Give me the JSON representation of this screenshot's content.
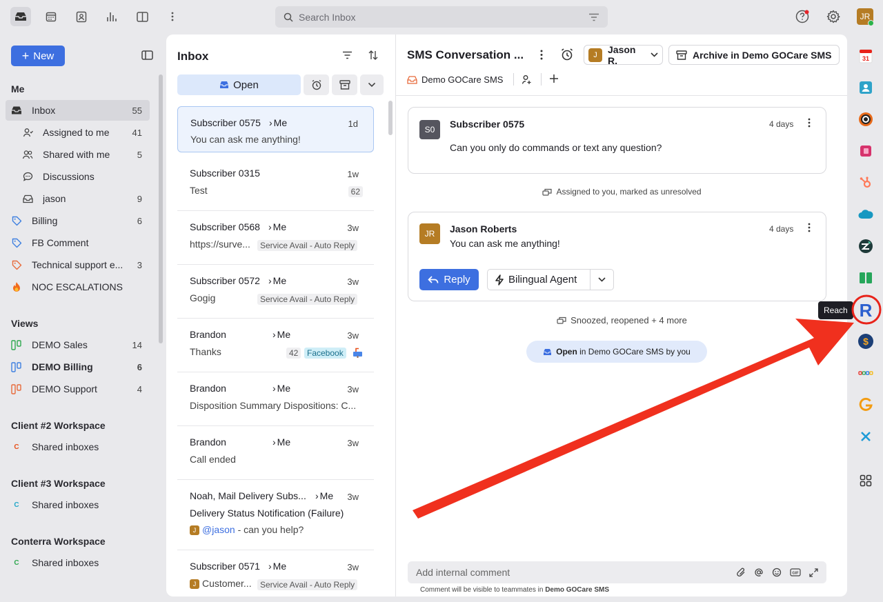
{
  "topbar": {
    "search_placeholder": "Search Inbox",
    "avatar_initials": "JR",
    "icons": [
      "inbox-icon",
      "calendar-icon",
      "contacts-icon",
      "analytics-icon",
      "columns-icon",
      "more-icon"
    ]
  },
  "sidebar": {
    "new_label": "New",
    "me_heading": "Me",
    "me_items": [
      {
        "label": "Inbox",
        "count": "55"
      },
      {
        "label": "Assigned to me",
        "count": "41"
      },
      {
        "label": "Shared with me",
        "count": "5"
      },
      {
        "label": "Discussions",
        "count": ""
      },
      {
        "label": "jason",
        "count": "9"
      },
      {
        "label": "Billing",
        "count": "6"
      },
      {
        "label": "FB Comment",
        "count": ""
      },
      {
        "label": "Technical support e...",
        "count": "3"
      },
      {
        "label": "NOC ESCALATIONS",
        "count": ""
      }
    ],
    "views_heading": "Views",
    "views": [
      {
        "label": "DEMO Sales",
        "count": "14"
      },
      {
        "label": "DEMO Billing",
        "count": "6"
      },
      {
        "label": "DEMO Support",
        "count": "4"
      }
    ],
    "workspaces": [
      {
        "heading": "Client #2 Workspace",
        "item": "Shared inboxes",
        "dot": "C"
      },
      {
        "heading": "Client #3 Workspace",
        "item": "Shared inboxes",
        "dot": "C"
      },
      {
        "heading": "Conterra Workspace",
        "item": "Shared inboxes",
        "dot": "C"
      }
    ]
  },
  "list": {
    "title": "Inbox",
    "open_label": "Open",
    "rows": [
      {
        "name": "Subscriber 0575",
        "me": "Me",
        "time": "1d",
        "preview": "You can ask me anything!",
        "tag": "",
        "badge": ""
      },
      {
        "name": "Subscriber 0315",
        "me": "",
        "time": "1w",
        "preview": "Test",
        "tag": "",
        "badge": "62"
      },
      {
        "name": "Subscriber 0568",
        "me": "Me",
        "time": "3w",
        "preview": "https://surve...",
        "tag": "Service Avail - Auto Reply",
        "badge": ""
      },
      {
        "name": "Subscriber 0572",
        "me": "Me",
        "time": "3w",
        "preview": "Gogig",
        "tag": "Service Avail - Auto Reply",
        "badge": ""
      },
      {
        "name": "Brandon",
        "me": "Me",
        "time": "3w",
        "preview": "Thanks",
        "tag": "Facebook",
        "badge": "42"
      },
      {
        "name": "Brandon",
        "me": "Me",
        "time": "3w",
        "preview": "Disposition Summary Dispositions: C...",
        "tag": "",
        "badge": ""
      },
      {
        "name": "Brandon",
        "me": "Me",
        "time": "3w",
        "preview": "Call ended",
        "tag": "",
        "badge": ""
      },
      {
        "name": "Noah, Mail Delivery Subs...",
        "me": "Me",
        "time": "3w",
        "preview": "Delivery Status Notification (Failure)",
        "mention": "@jason",
        "mention_rest": " - can you help?",
        "tag": "",
        "badge": ""
      },
      {
        "name": "Subscriber 0571",
        "me": "Me",
        "time": "3w",
        "preview": "Customer...",
        "tag": "Service Avail - Auto Reply",
        "badge": ""
      }
    ]
  },
  "conversation": {
    "title": "SMS Conversation ...",
    "assignee": "Jason R.",
    "assignee_initial": "J",
    "archive_label": "Archive in Demo GOCare SMS",
    "inbox_label": "Demo GOCare SMS",
    "messages": [
      {
        "initials": "S0",
        "author": "Subscriber 0575",
        "time": "4 days",
        "body": "Can you only do commands or text any question?"
      },
      {
        "initials": "JR",
        "author": "Jason Roberts",
        "time": "4 days",
        "body": "You can ask me anything!"
      }
    ],
    "event1": "Assigned to you, marked as unresolved",
    "event2": "Snoozed, reopened + 4 more",
    "status_bold": "Open",
    "status_rest": " in Demo GOCare SMS by you",
    "reply_label": "Reply",
    "agent_label": "Bilingual Agent",
    "comment_placeholder": "Add internal comment",
    "comment_note": "Comment will be visible to teammates in",
    "comment_note_bold": "Demo GOCare SMS"
  },
  "rail": {
    "tooltip": "Reach",
    "reach_letter": "R",
    "calendar_day": "31",
    "colors": {
      "accent": "#3d6fe0",
      "highlight": "#e8231a"
    }
  }
}
